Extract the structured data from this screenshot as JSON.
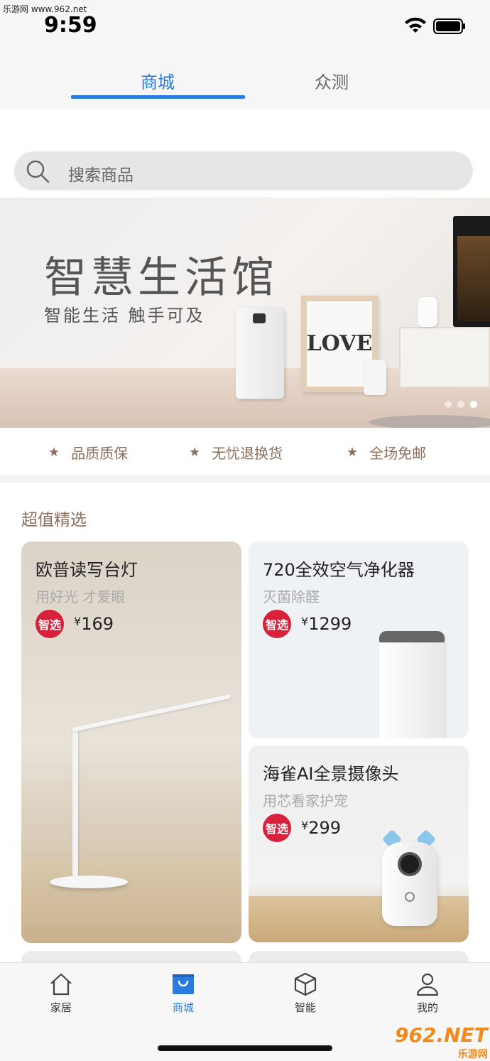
{
  "watermark_top": "乐游网 www.962.net",
  "status": {
    "time": "9:59"
  },
  "top_tabs": [
    {
      "label": "商城",
      "active": true
    },
    {
      "label": "众测",
      "active": false
    }
  ],
  "search": {
    "placeholder": "搜索商品"
  },
  "banner": {
    "title": "智慧生活馆",
    "subtitle": "智能生活  触手可及",
    "frame_text": "LOVE",
    "dots": 3,
    "active_dot": 3
  },
  "features": [
    {
      "label": "品质质保",
      "icon": "star-icon"
    },
    {
      "label": "无忧退换货",
      "icon": "star-icon"
    },
    {
      "label": "全场免邮",
      "icon": "star-icon"
    }
  ],
  "section": {
    "title": "超值精选"
  },
  "products": [
    {
      "name": "欧普读写台灯",
      "tagline": "用好光 才爱眼",
      "badge": "智选",
      "currency": "¥",
      "price": "169"
    },
    {
      "name": "720全效空气净化器",
      "tagline": "灭菌除醛",
      "badge": "智选",
      "currency": "¥",
      "price": "1299"
    },
    {
      "name": "海雀AI全景摄像头",
      "tagline": "用芯看家护宠",
      "badge": "智选",
      "currency": "¥",
      "price": "299"
    }
  ],
  "bottom_tabs": [
    {
      "label": "家居",
      "icon": "home-icon",
      "active": false
    },
    {
      "label": "商城",
      "icon": "shopping-bag-icon",
      "active": true
    },
    {
      "label": "智能",
      "icon": "cube-icon",
      "active": false
    },
    {
      "label": "我的",
      "icon": "user-icon",
      "active": false
    }
  ],
  "watermark_bottom": {
    "main": "962.NET",
    "sub": "乐游网"
  },
  "colors": {
    "accent": "#2a7be0",
    "badge": "#d8213b",
    "brown": "#8b6f5c"
  }
}
